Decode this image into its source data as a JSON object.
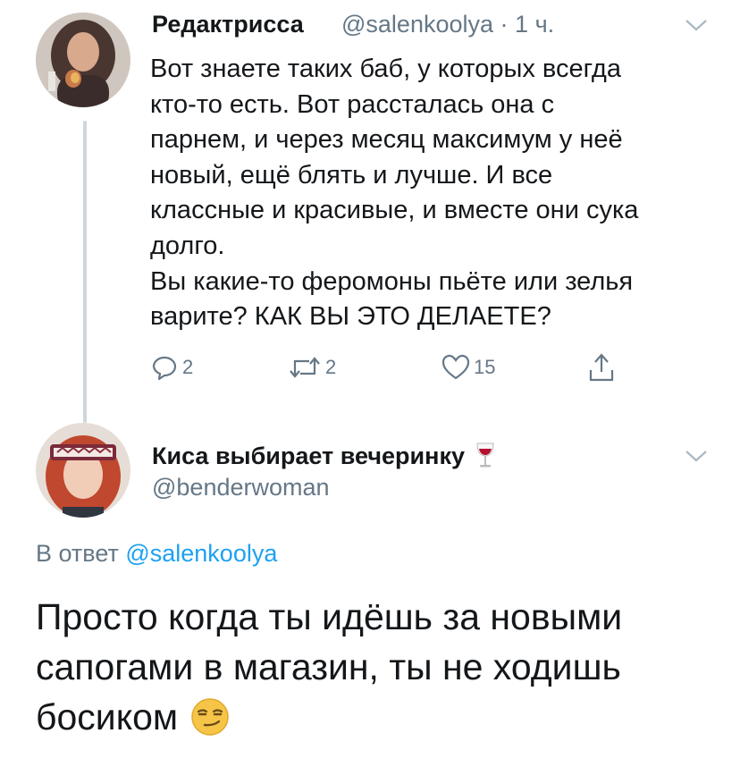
{
  "tweet1": {
    "author_name": "Редактрисса",
    "handle": "@salenkoolya",
    "separator": "·",
    "time": "1 ч.",
    "text_lines": [
      "Вот знаете таких баб, у которых всегда",
      "кто-то есть. Вот рассталась она с",
      "парнем, и через месяц максимум у неё",
      "новый, ещё блять и лучше. И все",
      "классные и красивые, и вместе они сука",
      "долго.",
      "Вы какие-то феромоны пьёте или зелья",
      "варите? КАК ВЫ ЭТО ДЕЛАЕТЕ?"
    ],
    "actions": {
      "replies": "2",
      "retweets": "2",
      "likes": "15"
    }
  },
  "tweet2": {
    "author_name": "Киса выбирает вечеринку",
    "name_emoji": "wine-glass-icon",
    "handle": "@benderwoman",
    "reply_prefix": "В ответ",
    "reply_to": "@salenkoolya",
    "text_lines": [
      "Просто когда ты идёшь за новыми",
      "сапогами в магазин, ты не ходишь",
      "босиком"
    ],
    "text_emoji": "smirking-face-icon"
  },
  "colors": {
    "text": "#14171a",
    "secondary": "#657786",
    "link": "#1da1f2",
    "thread_line": "#ccd6dd"
  }
}
